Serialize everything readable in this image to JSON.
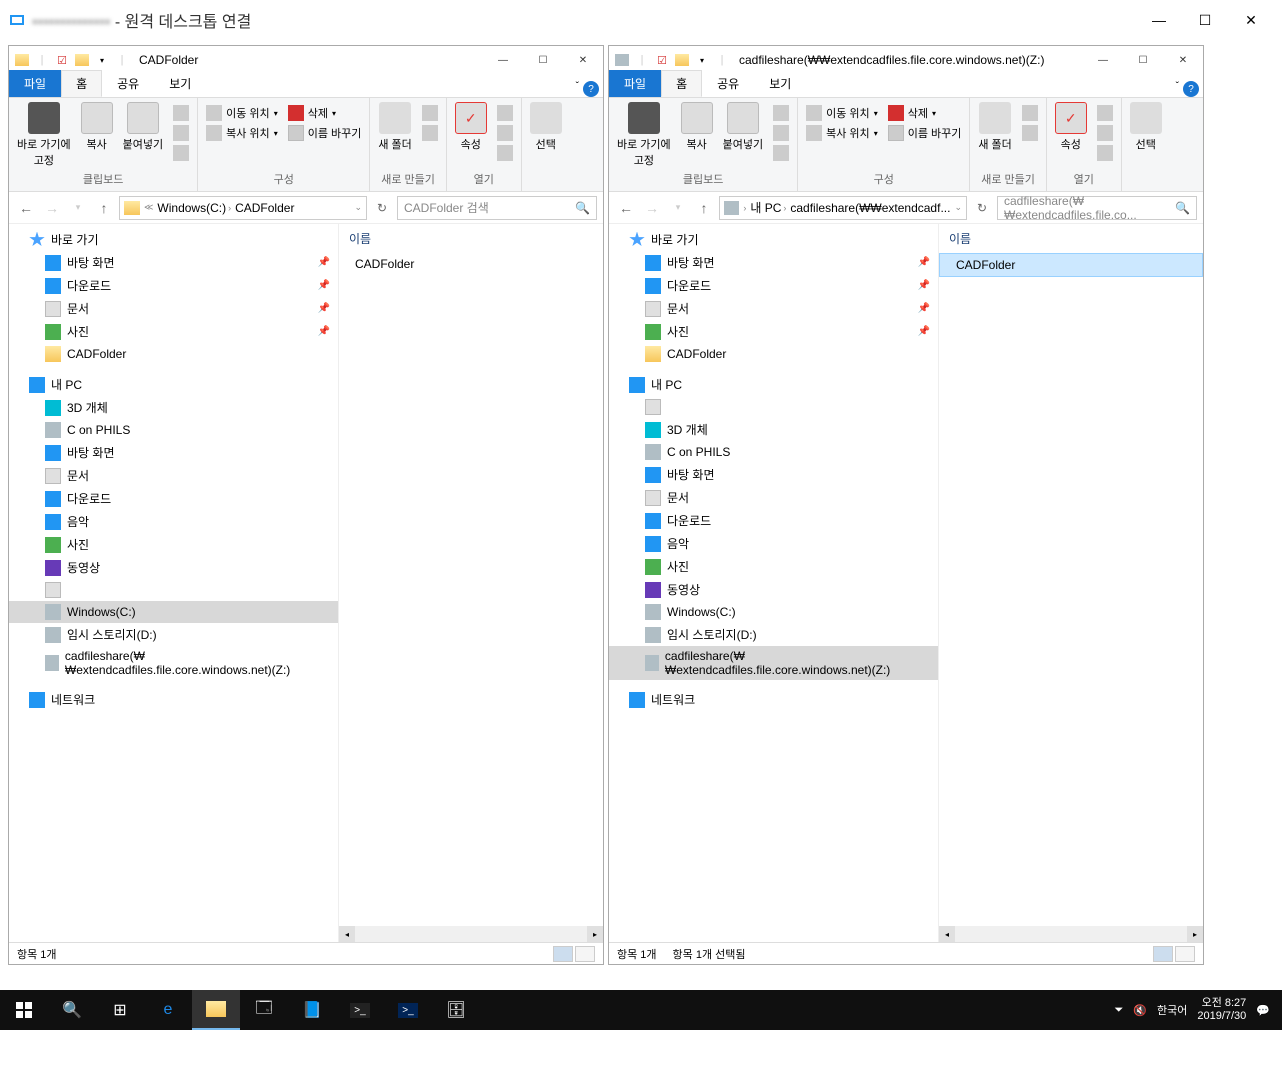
{
  "rdp": {
    "title_suffix": " - 원격 데스크톱 연결"
  },
  "leftWindow": {
    "title": "CADFolder",
    "tabs": {
      "file": "파일",
      "home": "홈",
      "share": "공유",
      "view": "보기"
    },
    "ribbon": {
      "pin": "바로 가기에\n고정",
      "copy": "복사",
      "paste": "붙여넣기",
      "moveto": "이동 위치",
      "copyto": "복사 위치",
      "delete": "삭제",
      "rename": "이름 바꾸기",
      "newfolder": "새 폴더",
      "props": "속성",
      "select": "선택",
      "g_clip": "클립보드",
      "g_org": "구성",
      "g_new": "새로 만들기",
      "g_open": "열기"
    },
    "breadcrumb": {
      "a": "Windows(C:)",
      "b": "CADFolder"
    },
    "search_placeholder": "CADFolder 검색",
    "content_header": "이름",
    "content_item": "CADFolder",
    "nav": {
      "quick": "바로 가기",
      "desktop": "바탕 화면",
      "downloads": "다운로드",
      "documents": "문서",
      "pictures": "사진",
      "cadfolder": "CADFolder",
      "thispc": "내 PC",
      "obj3d": "3D 개체",
      "conphils": "C on PHILS",
      "desktop2": "바탕 화면",
      "docs2": "문서",
      "dl2": "다운로드",
      "music": "음악",
      "pics2": "사진",
      "videos": "동영상",
      "drive_c": "Windows(C:)",
      "drive_d": "임시 스토리지(D:)",
      "drive_z": "cadfileshare(₩₩extendcadfiles.file.core.windows.net)(Z:)",
      "network": "네트워크"
    },
    "status": "항목 1개"
  },
  "rightWindow": {
    "title": "cadfileshare(₩₩extendcadfiles.file.core.windows.net)(Z:)",
    "breadcrumb": {
      "a": "내 PC",
      "b": "cadfileshare(₩₩extendcadf..."
    },
    "search_placeholder": "cadfileshare(₩₩extendcadfiles.file.co...",
    "content_item": "CADFolder",
    "nav": {
      "drive_z": "cadfileshare(₩₩extendcadfiles.file.core.windows.net)(Z:)"
    },
    "status1": "항목 1개",
    "status2": "항목 1개 선택됨"
  },
  "taskbar": {
    "lang": "한국어",
    "time": "오전 8:27",
    "date": "2019/7/30"
  }
}
